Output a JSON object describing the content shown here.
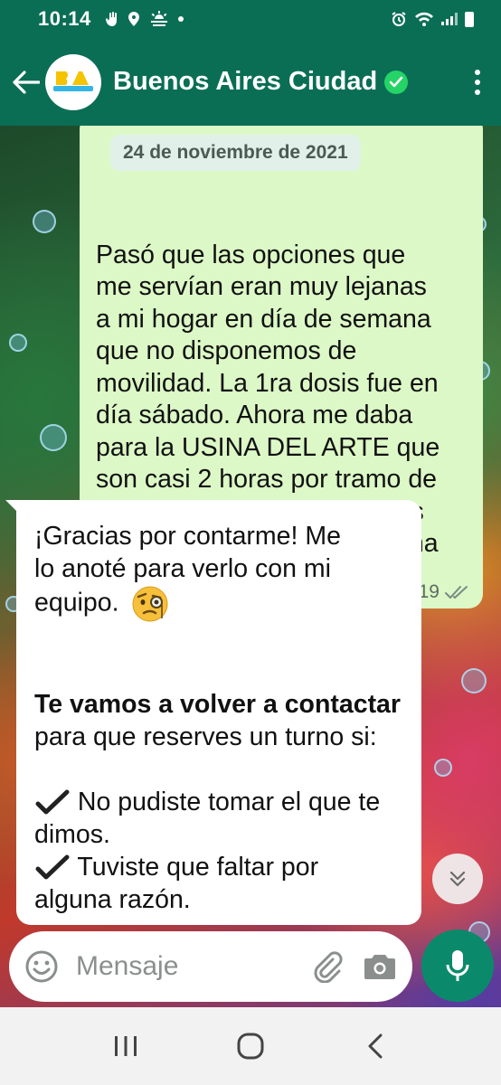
{
  "status_bar": {
    "time": "10:14",
    "left_icons": [
      "hand-icon",
      "location-icon",
      "weather-icon",
      "dot-icon"
    ],
    "right_icons": [
      "alarm-icon",
      "wifi-icon",
      "signal-icon",
      "battery-icon"
    ]
  },
  "header": {
    "contact_name": "Buenos Aires Ciudad",
    "avatar_text": "BA",
    "verified": true,
    "accent_color": "#0a6e55"
  },
  "chat": {
    "date_chip": "24 de noviembre de 2021",
    "outgoing": {
      "partial_lines": "Pasó que las opciones que\nme servían eran muy lejanas",
      "text": "a mi hogar en día de semana\nque no disponemos de\nmovilidad. La 1ra dosis fue en\ndía sábado. Ahora me daba\npara la USINA DEL ARTE que\nson casi 2 horas por tramo de\nviaje en colectivo.  Las sedes\ncercanas como velez o gaona\nfiguraban agotadas",
      "time": "16:19",
      "status": "read",
      "bubble_color": "#dcf8c6"
    },
    "incoming": {
      "line1": "¡Gracias por contarme! Me",
      "line2": "lo anoté para verlo con mi",
      "line3": "equipo.",
      "emoji": "face-with-monocle",
      "bold_line": "Te vamos a volver a contactar",
      "line4": "para que reserves un turno si:",
      "check1_a": "No pudiste tomar el que te",
      "check1_b": "dimos.",
      "check2_a": "Tuviste que faltar por",
      "check2_b": "alguna razón."
    }
  },
  "composer": {
    "placeholder": "Mensaje"
  },
  "nav": {
    "items": [
      "recents",
      "home",
      "back"
    ]
  }
}
